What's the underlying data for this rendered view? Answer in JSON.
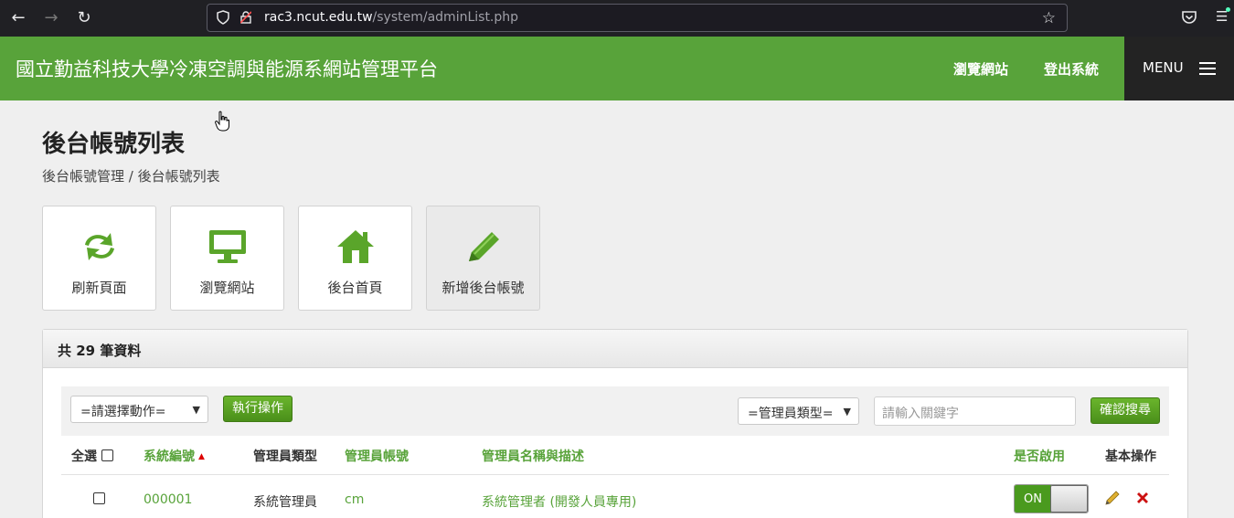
{
  "browser": {
    "url_host": "rac3.ncut.edu.tw",
    "url_path": "/system/adminList.php"
  },
  "header": {
    "title": "國立勤益科技大學冷凍空調與能源系網站管理平台",
    "links": [
      "瀏覽網站",
      "登出系統"
    ],
    "menu_label": "MENU"
  },
  "page": {
    "title": "後台帳號列表",
    "breadcrumb": "後台帳號管理 / 後台帳號列表"
  },
  "tiles": [
    {
      "label": "刷新頁面",
      "icon": "refresh-icon"
    },
    {
      "label": "瀏覽網站",
      "icon": "monitor-icon"
    },
    {
      "label": "後台首頁",
      "icon": "home-icon"
    },
    {
      "label": "新增後台帳號",
      "icon": "pencil-icon"
    }
  ],
  "panel": {
    "count_text": "共 29 筆資料"
  },
  "toolbar": {
    "action_select": "=請選擇動作=",
    "execute_label": "執行操作",
    "type_select": "=管理員類型=",
    "keyword_placeholder": "請輸入關鍵字",
    "search_label": "確認搜尋"
  },
  "table": {
    "headers": {
      "select_all": "全選",
      "id": "系統編號",
      "type": "管理員類型",
      "account": "管理員帳號",
      "name": "管理員名稱與描述",
      "enabled": "是否啟用",
      "ops": "基本操作"
    },
    "rows": [
      {
        "id": "000001",
        "type": "系統管理員",
        "account": "cm",
        "name": "系統管理者 (開發人員專用)",
        "enabled": "ON"
      }
    ]
  },
  "colors": {
    "brand_green": "#58a33a",
    "dark": "#232323",
    "delete_red": "#cc1111"
  }
}
